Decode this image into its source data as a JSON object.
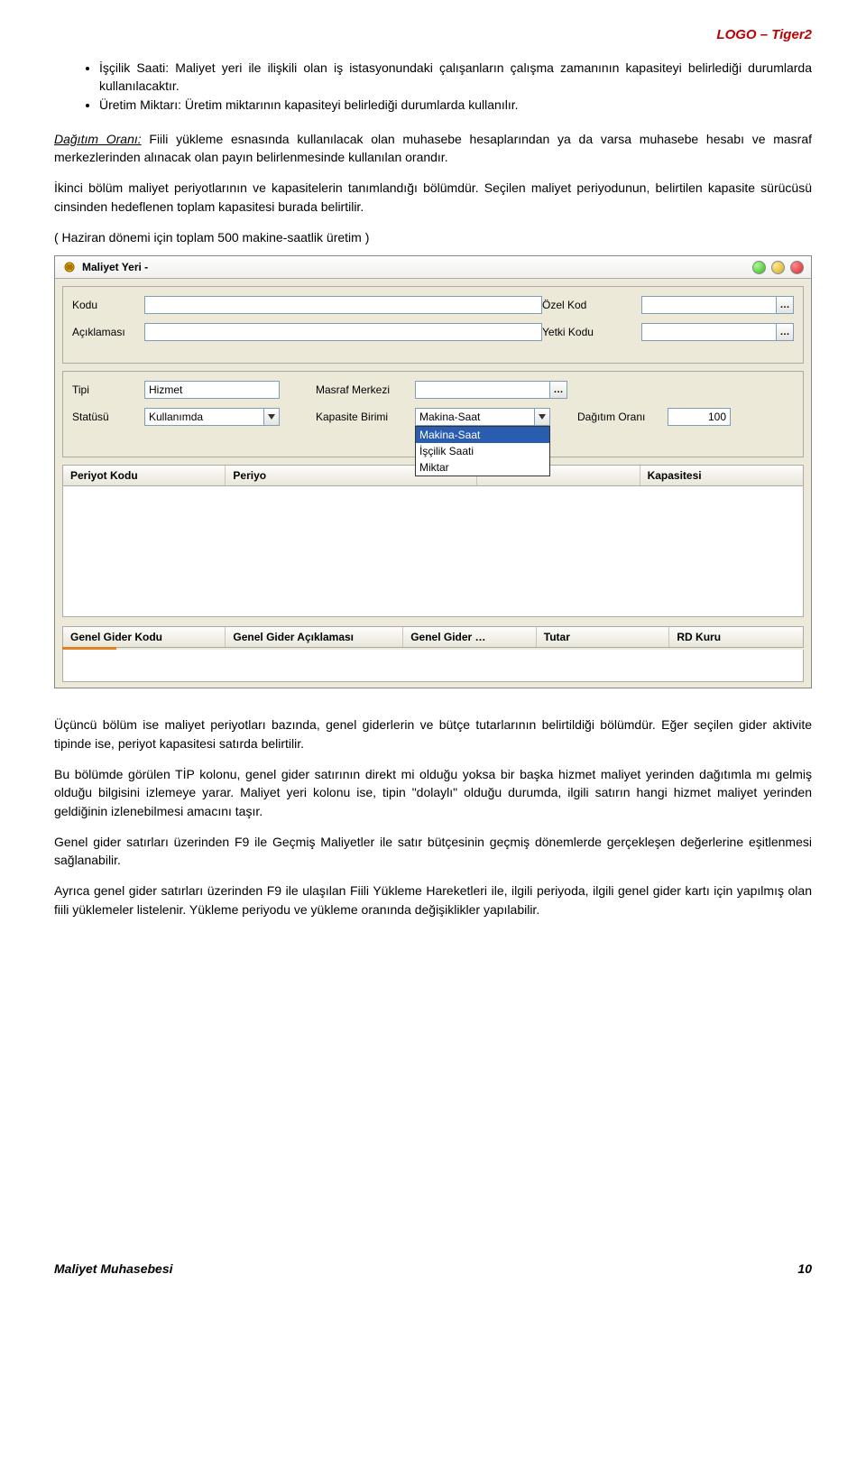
{
  "header": {
    "logo": "LOGO – Tiger2"
  },
  "bullets": [
    "İşçilik Saati: Maliyet yeri ile ilişkili olan iş istasyonundaki çalışanların çalışma zamanının kapasiteyi belirlediği durumlarda kullanılacaktır.",
    "Üretim Miktarı: Üretim miktarının kapasiteyi belirlediği durumlarda kullanılır."
  ],
  "p1_lead": "Dağıtım Oranı:",
  "p1_rest": " Fiili yükleme esnasında kullanılacak olan muhasebe hesaplarından ya da varsa muhasebe hesabı ve masraf merkezlerinden alınacak olan payın belirlenmesinde kullanılan orandır.",
  "p2": "İkinci bölüm maliyet periyotlarının ve kapasitelerin tanımlandığı bölümdür. Seçilen maliyet periyodunun, belirtilen kapasite sürücüsü cinsinden hedeflenen toplam kapasitesi burada belirtilir.",
  "p3": "( Haziran dönemi için toplam 500 makine-saatlik üretim )",
  "window": {
    "title": "Maliyet Yeri -",
    "labels": {
      "kodu": "Kodu",
      "aciklamasi": "Açıklaması",
      "ozel_kod": "Özel Kod",
      "yetki_kodu": "Yetki Kodu",
      "tipi": "Tipi",
      "statusu": "Statüsü",
      "masraf_merkezi": "Masraf Merkezi",
      "kapasite_birimi": "Kapasite Birimi",
      "dagitim_orani": "Dağıtım Oranı"
    },
    "values": {
      "tipi": "Hizmet",
      "statusu": "Kullanımda",
      "kapasite_birimi": "Makina-Saat",
      "dagitim_orani": "100"
    },
    "kapasite_options": [
      "Makina-Saat",
      "İşçilik Saati",
      "Miktar"
    ],
    "grid1_headers": {
      "a": "Periyot Kodu",
      "b": "Periyo",
      "c": "",
      "d": "Kapasitesi"
    },
    "grid2_headers": {
      "a": "Genel Gider Kodu",
      "b": "Genel Gider Açıklaması",
      "c": "Genel Gider …",
      "d": "Tutar",
      "e": "RD Kuru"
    }
  },
  "p4": "Üçüncü bölüm ise maliyet periyotları bazında, genel giderlerin ve bütçe tutarlarının belirtildiği bölümdür. Eğer seçilen gider aktivite tipinde ise, periyot kapasitesi satırda belirtilir.",
  "p5": "Bu bölümde görülen TİP kolonu, genel gider satırının direkt mi olduğu yoksa bir başka hizmet maliyet yerinden dağıtımla mı gelmiş olduğu bilgisini izlemeye yarar. Maliyet yeri kolonu ise, tipin \"dolaylı\" olduğu durumda, ilgili satırın hangi hizmet maliyet yerinden geldiğinin izlenebilmesi amacını taşır.",
  "p6": "Genel gider satırları üzerinden F9 ile Geçmiş Maliyetler ile satır bütçesinin geçmiş dönemlerde gerçekleşen değerlerine eşitlenmesi sağlanabilir.",
  "p7": "Ayrıca genel gider satırları üzerinden F9 ile ulaşılan Fiili Yükleme Hareketleri ile, ilgili periyoda, ilgili genel gider kartı için yapılmış olan fiili yüklemeler listelenir. Yükleme periyodu ve yükleme oranında değişiklikler yapılabilir.",
  "footer": {
    "left": "Maliyet Muhasebesi",
    "right": "10"
  }
}
